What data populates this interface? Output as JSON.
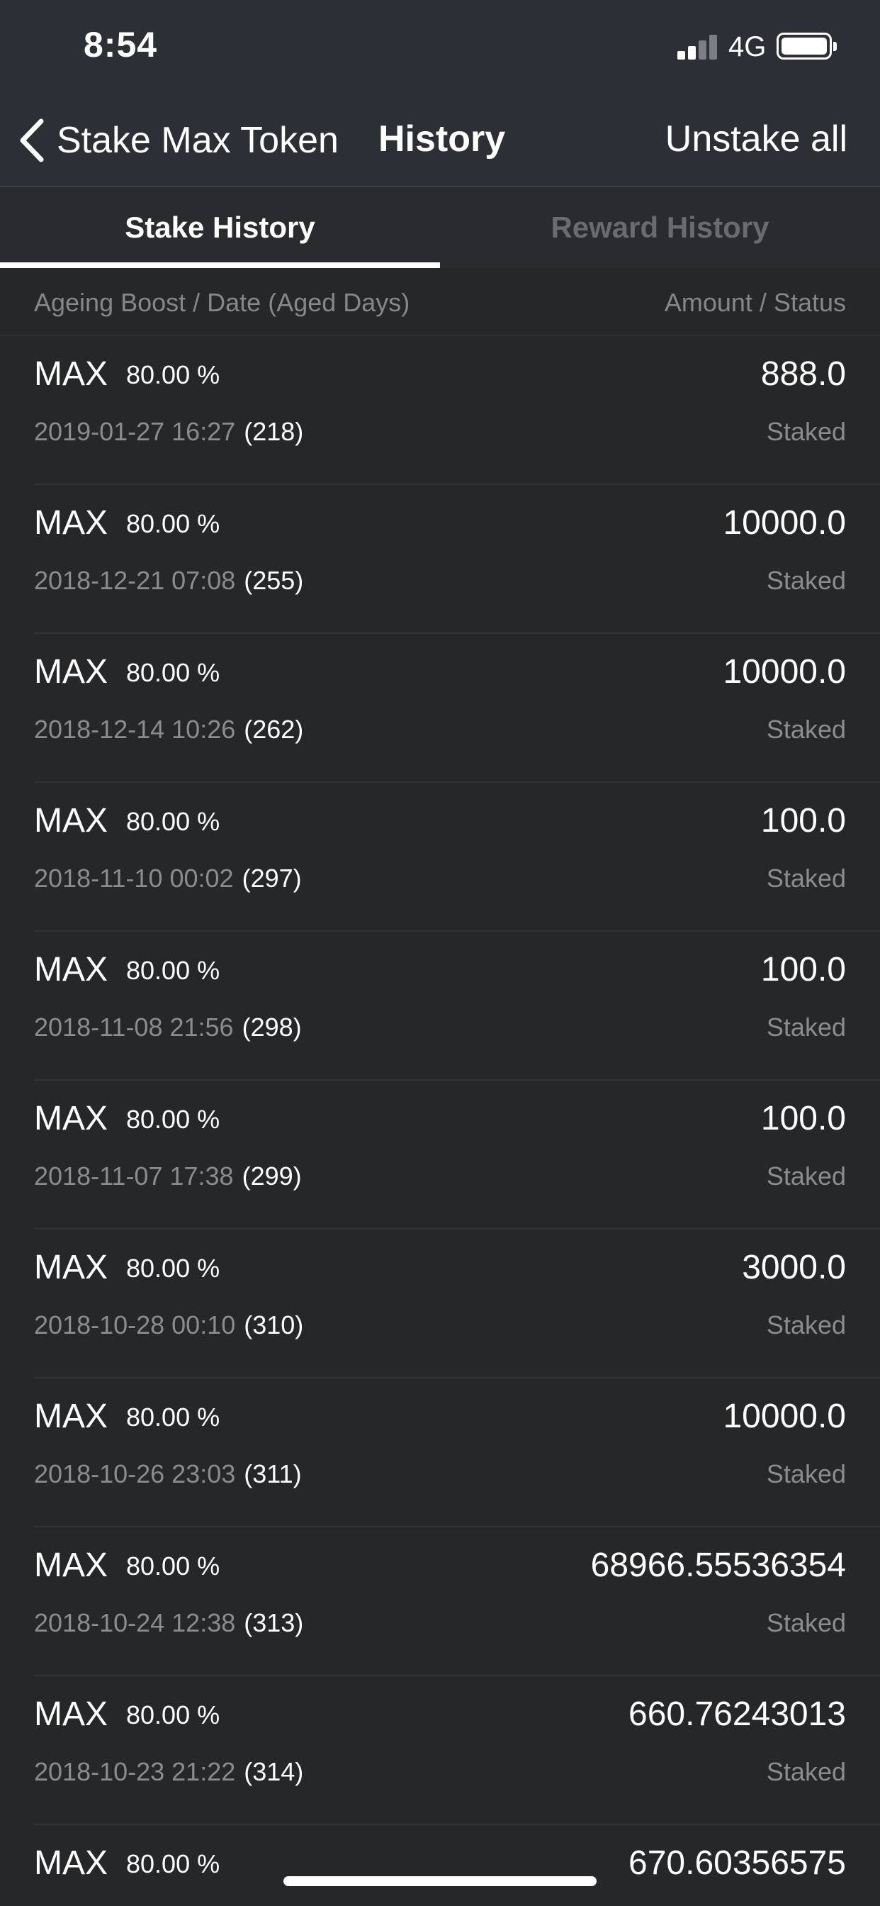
{
  "status_bar": {
    "time": "8:54",
    "network": "4G",
    "signal_bars_active": 2,
    "signal_bars_total": 4,
    "battery_icon": "battery-full-icon"
  },
  "nav": {
    "back_label": "Stake Max Token",
    "back_icon": "chevron-left-icon",
    "title": "History",
    "action_label": "Unstake all"
  },
  "tabs": [
    {
      "label": "Stake History",
      "active": true
    },
    {
      "label": "Reward History",
      "active": false
    }
  ],
  "columns": {
    "left": "Ageing Boost / Date (Aged Days)",
    "right": "Amount / Status"
  },
  "rows": [
    {
      "token": "MAX",
      "boost": "80.00 %",
      "date": "2019-01-27 16:27",
      "days": "(218)",
      "amount": "888.0",
      "status": "Staked"
    },
    {
      "token": "MAX",
      "boost": "80.00 %",
      "date": "2018-12-21 07:08",
      "days": "(255)",
      "amount": "10000.0",
      "status": "Staked"
    },
    {
      "token": "MAX",
      "boost": "80.00 %",
      "date": "2018-12-14 10:26",
      "days": "(262)",
      "amount": "10000.0",
      "status": "Staked"
    },
    {
      "token": "MAX",
      "boost": "80.00 %",
      "date": "2018-11-10 00:02",
      "days": "(297)",
      "amount": "100.0",
      "status": "Staked"
    },
    {
      "token": "MAX",
      "boost": "80.00 %",
      "date": "2018-11-08 21:56",
      "days": "(298)",
      "amount": "100.0",
      "status": "Staked"
    },
    {
      "token": "MAX",
      "boost": "80.00 %",
      "date": "2018-11-07 17:38",
      "days": "(299)",
      "amount": "100.0",
      "status": "Staked"
    },
    {
      "token": "MAX",
      "boost": "80.00 %",
      "date": "2018-10-28 00:10",
      "days": "(310)",
      "amount": "3000.0",
      "status": "Staked"
    },
    {
      "token": "MAX",
      "boost": "80.00 %",
      "date": "2018-10-26 23:03",
      "days": "(311)",
      "amount": "10000.0",
      "status": "Staked"
    },
    {
      "token": "MAX",
      "boost": "80.00 %",
      "date": "2018-10-24 12:38",
      "days": "(313)",
      "amount": "68966.55536354",
      "status": "Staked"
    },
    {
      "token": "MAX",
      "boost": "80.00 %",
      "date": "2018-10-23 21:22",
      "days": "(314)",
      "amount": "660.76243013",
      "status": "Staked"
    },
    {
      "token": "MAX",
      "boost": "80.00 %",
      "date": "",
      "days": "",
      "amount": "670.60356575",
      "status": ""
    }
  ],
  "colors": {
    "background": "#262729",
    "header_background": "#2c2f36",
    "primary_text": "#ffffff",
    "secondary_text": "#8b8c90",
    "inactive_tab": "#6a6b6f"
  }
}
